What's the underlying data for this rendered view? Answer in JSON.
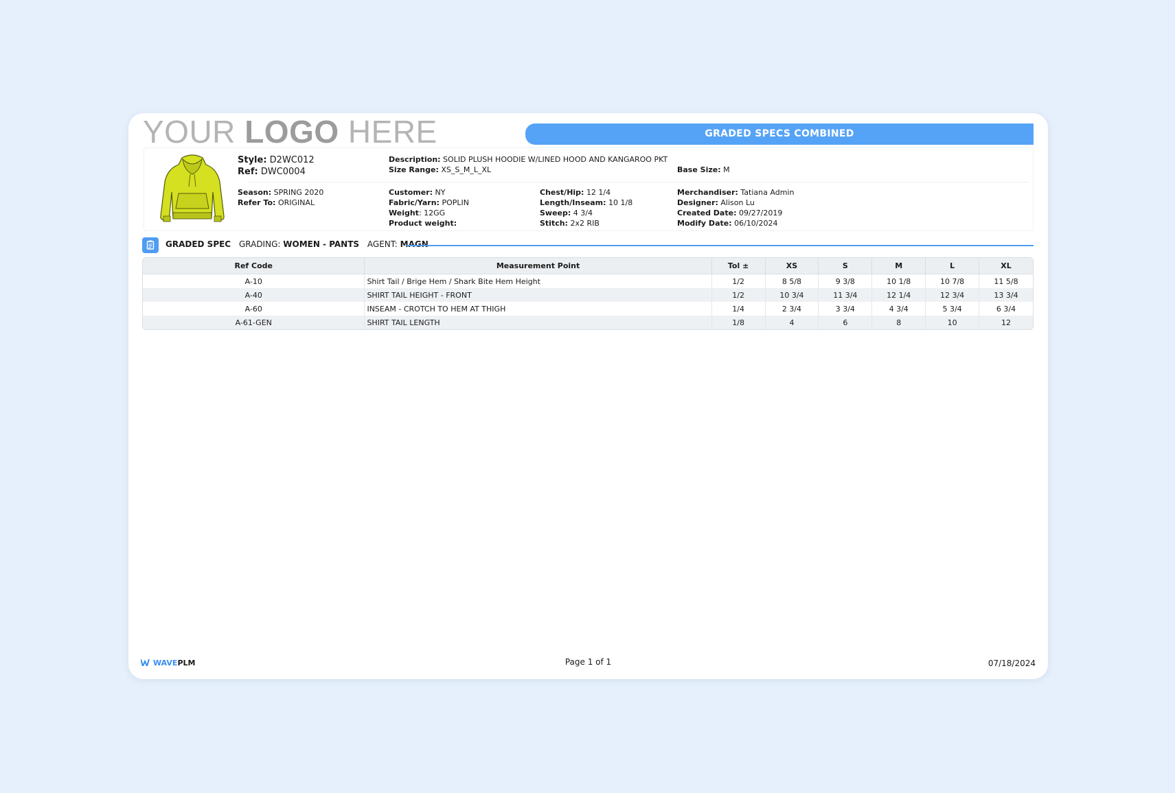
{
  "header": {
    "logo_parts": [
      "YOUR",
      "LOGO",
      "HERE"
    ],
    "banner_title": "GRADED SPECS COMBINED"
  },
  "style_info": {
    "style_label": "Style:",
    "style_value": "D2WC012",
    "ref_label": "Ref:",
    "ref_value": "DWC0004",
    "season_label": "Season:",
    "season_value": "SPRING 2020",
    "refer_to_label": "Refer To:",
    "refer_to_value": "ORIGINAL",
    "description_label": "Description:",
    "description_value": "SOLID PLUSH HOODIE W/LINED HOOD AND KANGAROO PKT",
    "size_range_label": "Size Range:",
    "size_range_value": "XS_S_M_L_XL",
    "base_size_label": "Base Size:",
    "base_size_value": "M",
    "customer_label": "Customer:",
    "customer_value": "NY",
    "fabric_label": "Fabric/Yarn:",
    "fabric_value": "POPLIN",
    "weight_label": "Weight",
    "weight_value": ": 12GG",
    "product_weight_label": "Product weight:",
    "product_weight_value": "",
    "chest_label": "Chest/Hip:",
    "chest_value": "12 1/4",
    "length_label": "Length/Inseam:",
    "length_value": "10 1/8",
    "sweep_label": "Sweep:",
    "sweep_value": "4 3/4",
    "stitch_label": "Stitch:",
    "stitch_value": "2x2 RIB",
    "merch_label": "Merchandiser:",
    "merch_value": "Tatiana Admin",
    "designer_label": "Designer:",
    "designer_value": "Alison Lu",
    "created_label": "Created Date:",
    "created_value": "09/27/2019",
    "modify_label": "Modify Date:",
    "modify_value": "06/10/2024",
    "garment_icon": "hoodie-sketch",
    "garment_color": "#d4e020"
  },
  "section": {
    "title": "GRADED SPEC",
    "grading_label": "GRADING:",
    "grading_value": "WOMEN - PANTS",
    "agent_label": "AGENT:",
    "agent_value": "MAGN",
    "icon": "clipboard-icon",
    "accent": "#4f9cf2"
  },
  "spec_table": {
    "columns": [
      "Ref Code",
      "Measurement Point",
      "Tol ±",
      "XS",
      "S",
      "M",
      "L",
      "XL"
    ],
    "rows": [
      [
        "A-10",
        "Shirt Tail / Brige Hem / Shark Bite Hem Height",
        "1/2",
        "8 5/8",
        "9 3/8",
        "10 1/8",
        "10 7/8",
        "11 5/8"
      ],
      [
        "A-40",
        "SHIRT TAIL HEIGHT - FRONT",
        "1/2",
        "10 3/4",
        "11 3/4",
        "12 1/4",
        "12 3/4",
        "13 3/4"
      ],
      [
        "A-60",
        "INSEAM - CROTCH TO HEM AT THIGH",
        "1/4",
        "2 3/4",
        "3 3/4",
        "4 3/4",
        "5 3/4",
        "6 3/4"
      ],
      [
        "A-61-GEN",
        "SHIRT TAIL LENGTH",
        "1/8",
        "4",
        "6",
        "8",
        "10",
        "12"
      ]
    ]
  },
  "footer": {
    "brand_wave": "WAVE",
    "brand_plm": "PLM",
    "page": "Page 1 of 1",
    "date": "07/18/2024"
  }
}
